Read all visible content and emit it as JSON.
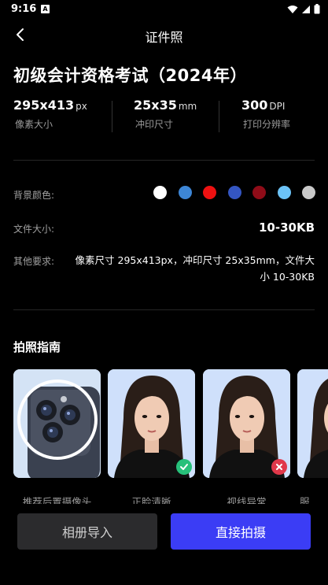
{
  "status_bar": {
    "time": "9:16",
    "notification_letter": "A"
  },
  "header": {
    "title": "证件照"
  },
  "exam": {
    "title": "初级会计资格考试（2024年）"
  },
  "specs": [
    {
      "value": "295x413",
      "unit": "px",
      "label": "像素大小"
    },
    {
      "value": "25x35",
      "unit": "mm",
      "label": "冲印尺寸"
    },
    {
      "value": "300",
      "unit": "DPI",
      "label": "打印分辨率"
    }
  ],
  "background": {
    "label": "背景颜色:",
    "colors": [
      "#ffffff",
      "#3d86d6",
      "#ee1111",
      "#3456c2",
      "#8f0c18",
      "#6cc3f7",
      "#c9c9c9"
    ]
  },
  "file_size": {
    "label": "文件大小:",
    "value": "10-30KB"
  },
  "other_requirements": {
    "label": "其他要求:",
    "value": "像素尺寸 295x413px，冲印尺寸 25x35mm，文件大小 10-30KB"
  },
  "guide": {
    "title": "拍照指南",
    "items": [
      {
        "label": "推荐后置摄像头",
        "icon": "rear-camera-icon"
      },
      {
        "label": "正脸清晰",
        "icon": "check-icon",
        "status_color": "#27c07a"
      },
      {
        "label": "视线异常",
        "icon": "x-icon",
        "status_color": "#e0384a"
      },
      {
        "label": "服",
        "icon": ""
      }
    ]
  },
  "actions": {
    "import_label": "相册导入",
    "shoot_label": "直接拍摄",
    "accent": "#3b3df5"
  }
}
